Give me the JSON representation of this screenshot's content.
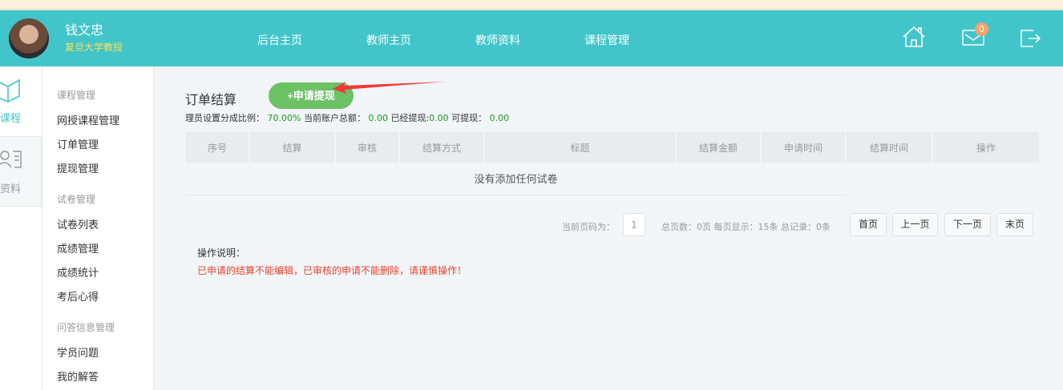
{
  "header": {
    "user_name": "钱文忠",
    "user_title": "复旦大学教授",
    "nav": [
      "后台主页",
      "教师主页",
      "教师资料",
      "课程管理"
    ],
    "message_count": "0",
    "icons": [
      "home-icon",
      "mail-icon",
      "logout-icon"
    ]
  },
  "sidebar_main": [
    {
      "label": "课程",
      "icon": "book-icon",
      "active": true
    },
    {
      "label": "资料",
      "icon": "profile-icon",
      "active": false
    }
  ],
  "sidebar_menu": {
    "sections": [
      {
        "title": "课程管理",
        "items": [
          "网授课程管理",
          "订单管理",
          "提现管理"
        ]
      },
      {
        "title": "试卷管理",
        "items": [
          "试卷列表",
          "成绩管理",
          "成绩统计",
          "考后心得"
        ]
      },
      {
        "title": "问答信息管理",
        "items": [
          "学员问题",
          "我的解答"
        ]
      }
    ]
  },
  "main": {
    "title": "订单结算",
    "apply_button": "+申请提现",
    "info": {
      "ratio_label": "理员设置分成比例：",
      "ratio": "70.00%",
      "total_label": "当前账户总额：",
      "total": "0.00",
      "withdrawn_label": "已经提现:",
      "withdrawn": "0.00",
      "available_label": "可提现：",
      "available": "0.00"
    },
    "columns": [
      "序号",
      "结算",
      "审核",
      "结算方式",
      "标题",
      "结算金额",
      "申请时间",
      "结算时间",
      "操作"
    ],
    "empty_text": "没有添加任何试卷",
    "pagination": {
      "current_label": "当前页码为：",
      "current": "1",
      "summary": "总页数：0页 每页显示：15条 总记录：0条",
      "first": "首页",
      "prev": "上一页",
      "next": "下一页",
      "last": "末页"
    },
    "note_title": "操作说明：",
    "note_warning": "已申请的结算不能编辑，已审核的申请不能删除，请谨慎操作！"
  },
  "colors": {
    "header": "#41c5ca",
    "accent_green": "#6cc165",
    "warning": "#e8442e",
    "badge": "#f5a36a"
  }
}
